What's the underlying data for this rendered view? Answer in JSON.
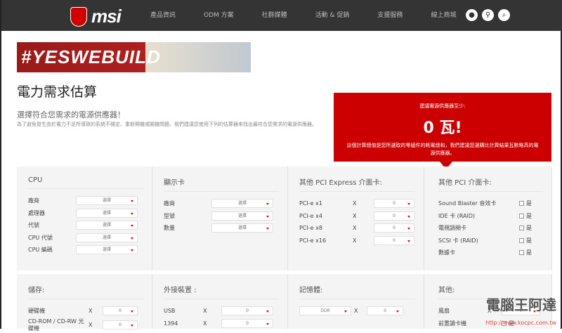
{
  "header": {
    "logo": "msi",
    "nav": [
      "產品資訊",
      "ODM 方案",
      "社群媒體",
      "活動 & 促銷",
      "支援服務",
      "線上商城"
    ],
    "icons": [
      "user-icon",
      "location-icon",
      "search-icon"
    ]
  },
  "banner": {
    "text": "#YESWEBUILD"
  },
  "page": {
    "title": "電力需求估算",
    "subtitle": "選擇符合您需求的電源供應器！",
    "description": "為了避免發生由於電力不足所導致的系統不穩定、重新開機或關機問題，我們建議您使用下列的估算器來找出最符合您需求的電源供應器。"
  },
  "result": {
    "label": "建議電源供應器至少:",
    "watts": "0 瓦!",
    "note": "這個計算總值是您所選取的零組件的耗電總和，我們建議您選購比計算結果瓦數略高的電源供應器。",
    "color": "#cc0000"
  },
  "cpu": {
    "title": "CPU",
    "rows": [
      {
        "label": "廠商",
        "value": "選擇"
      },
      {
        "label": "處理器",
        "value": "選擇"
      },
      {
        "label": "代號",
        "value": "選擇"
      },
      {
        "label": "CPU 代號",
        "value": "選擇"
      },
      {
        "label": "CPU 編碼",
        "value": "選擇"
      }
    ]
  },
  "gpu": {
    "title": "顯示卡",
    "rows": [
      {
        "label": "廠商",
        "value": "選擇"
      },
      {
        "label": "型號",
        "value": "選擇"
      },
      {
        "label": "數量",
        "value": "選擇"
      }
    ]
  },
  "pcie": {
    "title": "其他 PCI Express 介面卡:",
    "x": "X",
    "rows": [
      {
        "label": "PCI-e x1",
        "value": "0"
      },
      {
        "label": "PCI-e x4",
        "value": "0"
      },
      {
        "label": "PCI-e x8",
        "value": "0"
      },
      {
        "label": "PCI-e x16",
        "value": "0"
      }
    ]
  },
  "pci": {
    "title": "其他 PCI 介面卡:",
    "yes": "是",
    "rows": [
      "Sound Blaster 音效卡",
      "IDE 卡 (RAID)",
      "電視調頻卡",
      "SCSI 卡 (RAID)",
      "數據卡"
    ]
  },
  "storage": {
    "title": "儲存:",
    "x": "X",
    "rows": [
      {
        "label": "硬碟機",
        "value": "0"
      },
      {
        "label": "CD-ROM / CD-RW 光碟機",
        "value": "0"
      }
    ]
  },
  "external": {
    "title": "外接裝置 :",
    "x": "X",
    "rows": [
      {
        "label": "USB",
        "value": "0"
      },
      {
        "label": "1394",
        "value": "0"
      }
    ]
  },
  "memory": {
    "title": "記憶體:",
    "x": "X",
    "type": "DDR",
    "value": "0"
  },
  "other": {
    "title": "其他:",
    "x": "X",
    "rows": [
      {
        "label": "風扇",
        "value": "0"
      },
      {
        "label": "前置讀卡機",
        "yes": "是"
      }
    ]
  },
  "watermark": {
    "name": "電腦王阿達",
    "url": "http://www.kocpc.com.tw"
  }
}
